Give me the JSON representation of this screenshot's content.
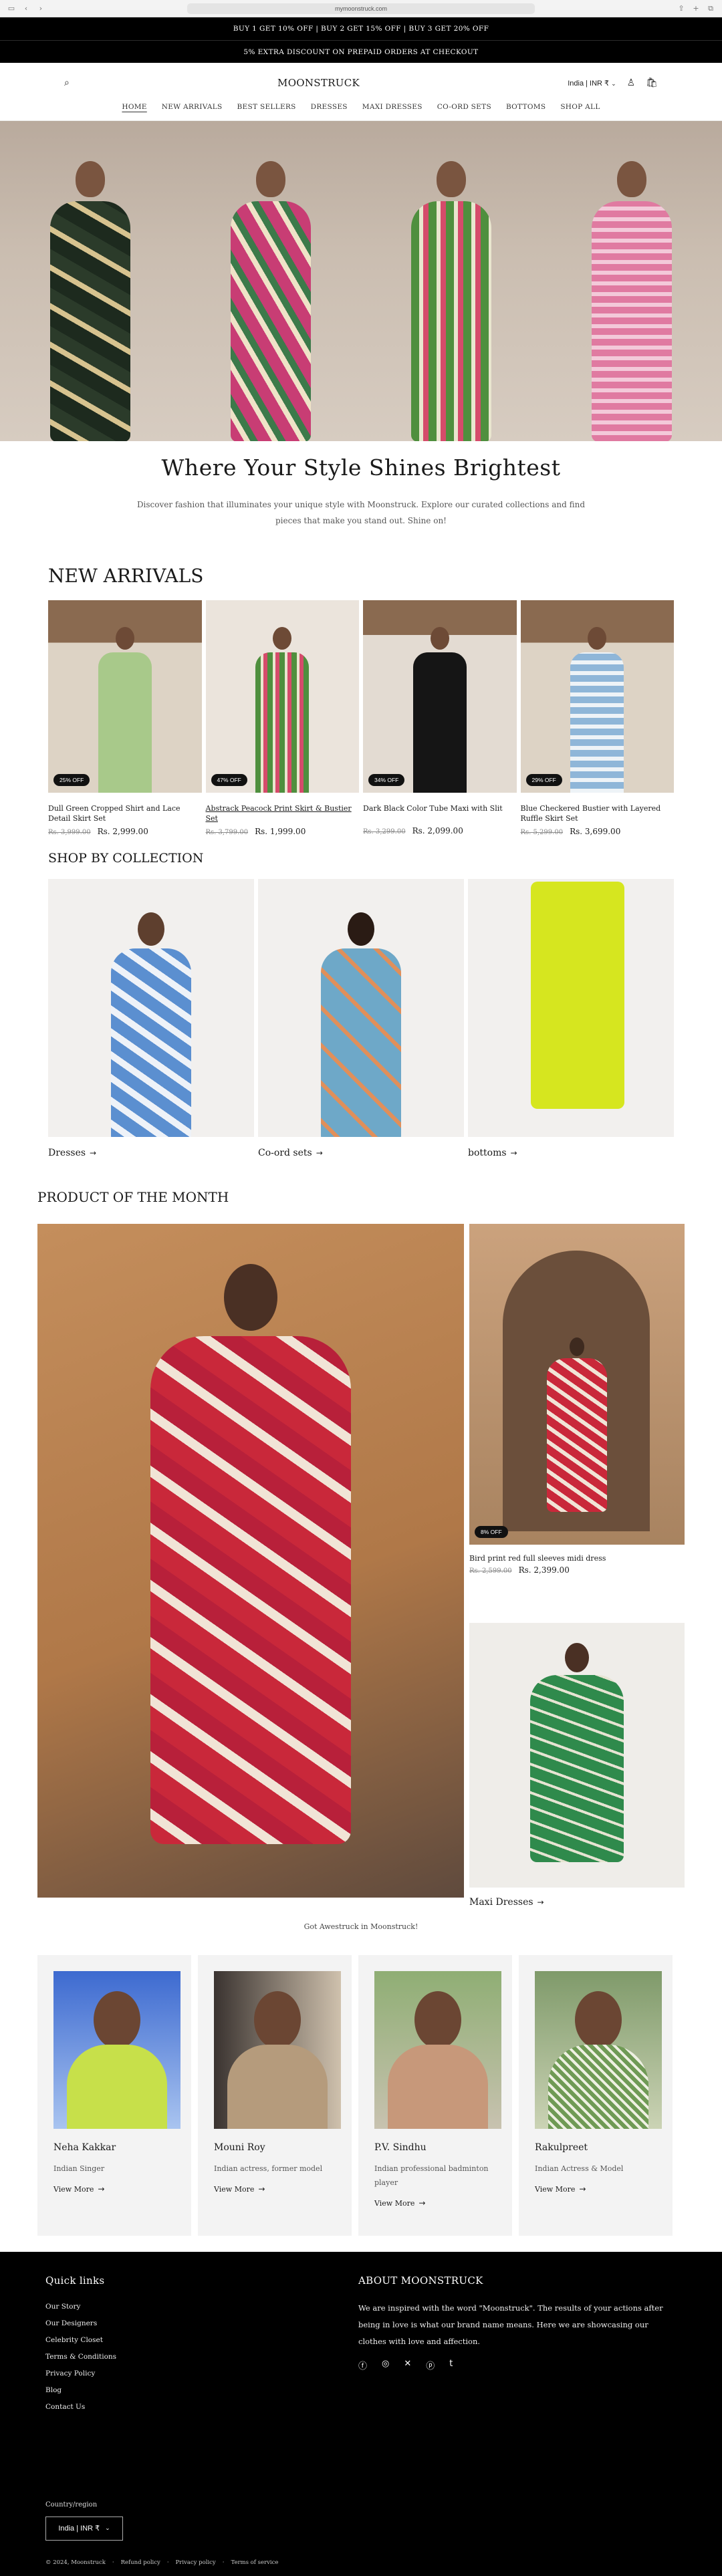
{
  "browser": {
    "url": "mymoonstruck.com"
  },
  "announcement": {
    "line1": "BUY 1 GET 10% OFF | BUY 2 GET 15% OFF | BUY 3 GET 20% OFF",
    "line2": "5% EXTRA DISCOUNT ON PREPAID ORDERS AT CHECKOUT"
  },
  "header": {
    "logo": "MOONSTRUCK",
    "currency": "India | INR ₹"
  },
  "nav": [
    "HOME",
    "NEW ARRIVALS",
    "BEST SELLERS",
    "DRESSES",
    "MAXI DRESSES",
    "CO-ORD SETS",
    "BOTTOMS",
    "SHOP ALL"
  ],
  "tagline": {
    "heading": "Where Your Style Shines Brightest",
    "body": "Discover fashion that illuminates your unique style with Moonstruck. Explore our curated collections and find pieces that make you stand out. Shine on!"
  },
  "new_arrivals": {
    "title": "NEW ARRIVALS",
    "products": [
      {
        "name": "Dull Green Cropped Shirt and Lace Detail Skirt Set",
        "badge": "25% OFF",
        "old_price": "Rs. 3,999.00",
        "price": "Rs. 2,999.00"
      },
      {
        "name": "Abstrack Peacock Print Skirt & Bustier Set",
        "badge": "47% OFF",
        "old_price": "Rs. 3,799.00",
        "price": "Rs. 1,999.00"
      },
      {
        "name": "Dark Black Color Tube Maxi with Slit",
        "badge": "34% OFF",
        "old_price": "Rs. 3,299.00",
        "price": "Rs. 2,099.00"
      },
      {
        "name": "Blue Checkered Bustier with Layered Ruffle Skirt Set",
        "badge": "29% OFF",
        "old_price": "Rs. 5,299.00",
        "price": "Rs. 3,699.00"
      }
    ]
  },
  "collections": {
    "title": "SHOP BY COLLECTION",
    "items": [
      {
        "label": "Dresses"
      },
      {
        "label": "Co-ord sets"
      },
      {
        "label": "bottoms"
      }
    ]
  },
  "product_of_month": {
    "title": "PRODUCT OF THE MONTH",
    "feature_name": "Bird print red full sleeves midi dress",
    "badge": "8% OFF",
    "old_price": "Rs. 2,599.00",
    "price": "Rs. 2,399.00",
    "secondary_label": "Maxi Dresses"
  },
  "swoon": "Got Awestruck in Moonstruck!",
  "celebrities": [
    {
      "name": "Neha Kakkar",
      "role": "Indian Singer",
      "link": "View More"
    },
    {
      "name": "Mouni Roy",
      "role": "Indian actress, former model",
      "link": "View More"
    },
    {
      "name": "P.V. Sindhu",
      "role": "Indian professional badminton player",
      "link": "View More"
    },
    {
      "name": "Rakulpreet",
      "role": "Indian Actress & Model",
      "link": "View More"
    }
  ],
  "footer": {
    "quick_links_title": "Quick links",
    "quick_links": [
      "Our Story",
      "Our Designers",
      "Celebrity Closet",
      "Terms & Conditions",
      "Privacy Policy",
      "Blog",
      "Contact Us"
    ],
    "about_title": "ABOUT MOONSTRUCK",
    "about_text": "We are inspired with the word \"Moonstruck\". The results of your actions after being in love is what our brand name means. Here we are showcasing our clothes with love and affection.",
    "country_label": "Country/region",
    "country_value": "India | INR ₹",
    "copyright": "© 2024, Moonstruck",
    "legal": [
      "Refund policy",
      "Privacy policy",
      "Terms of service"
    ]
  },
  "colors": {
    "announcement_bg": "#000000",
    "footer_bg": "#000000",
    "text": "#1a1a1a"
  },
  "icons": [
    "search-icon",
    "account-icon",
    "cart-icon",
    "chevron-down-icon",
    "arrow-right-icon",
    "facebook-icon",
    "instagram-icon",
    "x-icon",
    "pinterest-icon",
    "tumblr-icon"
  ]
}
